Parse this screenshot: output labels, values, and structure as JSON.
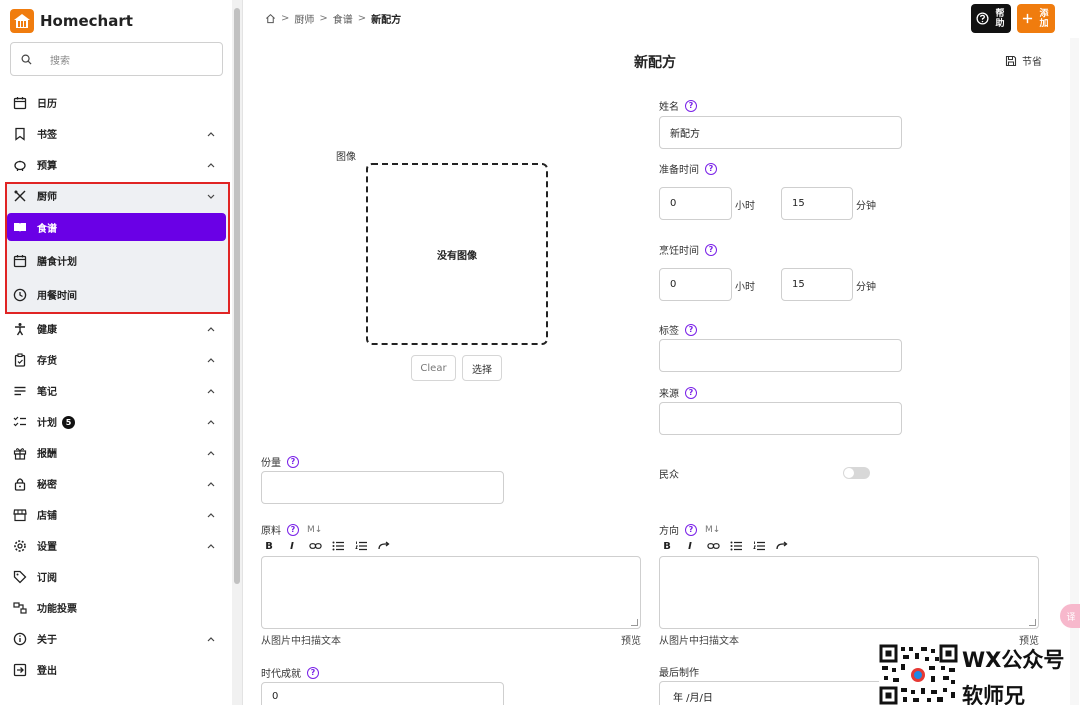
{
  "app": {
    "name": "Homechart"
  },
  "sidebar": {
    "search_placeholder": "搜索",
    "items": [
      {
        "label": "日历"
      },
      {
        "label": "书签"
      },
      {
        "label": "预算"
      },
      {
        "label": "厨师"
      },
      {
        "label": "食谱"
      },
      {
        "label": "膳食计划"
      },
      {
        "label": "用餐时间"
      },
      {
        "label": "健康"
      },
      {
        "label": "存货"
      },
      {
        "label": "笔记"
      },
      {
        "label": "计划",
        "badge": "5"
      },
      {
        "label": "报酬"
      },
      {
        "label": "秘密"
      },
      {
        "label": "店铺"
      },
      {
        "label": "设置"
      },
      {
        "label": "订阅"
      },
      {
        "label": "功能投票"
      },
      {
        "label": "关于"
      },
      {
        "label": "登出"
      }
    ]
  },
  "breadcrumb": {
    "items": [
      "厨师",
      "食谱",
      "新配方"
    ]
  },
  "topbar": {
    "help_label": "帮助",
    "add_label": "添加"
  },
  "page": {
    "title": "新配方",
    "save_label": "节省"
  },
  "form": {
    "image": {
      "label": "图像",
      "empty_text": "没有图像",
      "clear_label": "Clear",
      "select_label": "选择"
    },
    "name": {
      "label": "姓名",
      "value": "新配方"
    },
    "prep_time": {
      "label": "准备时间",
      "hours": "0",
      "hours_unit": "小时",
      "minutes": "15",
      "minutes_unit": "分钟"
    },
    "cook_time": {
      "label": "烹饪时间",
      "hours": "0",
      "hours_unit": "小时",
      "minutes": "15",
      "minutes_unit": "分钟"
    },
    "tags": {
      "label": "标签",
      "value": ""
    },
    "source": {
      "label": "来源",
      "value": ""
    },
    "servings": {
      "label": "份量",
      "value": ""
    },
    "public": {
      "label": "民众",
      "enabled": false
    },
    "ingredients": {
      "label": "原料",
      "markdown": "M↓",
      "scan_label": "从图片中扫描文本",
      "preview_label": "预览"
    },
    "directions": {
      "label": "方向",
      "markdown": "M↓",
      "scan_label": "从图片中扫描文本",
      "preview_label": "预览"
    },
    "times_made": {
      "label": "时代成就",
      "value": "0"
    },
    "last_made": {
      "label": "最后制作",
      "value": "年 /月/日"
    }
  },
  "toolbar": {
    "bold": "B",
    "italic": "I"
  },
  "help_glyph": "?",
  "watermark": {
    "line1": "WX公众号",
    "line2": "软师兄"
  },
  "translate_glyph": "译",
  "colors": {
    "accent": "#6a00e6",
    "brand": "#f07c0e",
    "highlight_border": "#e02424"
  }
}
